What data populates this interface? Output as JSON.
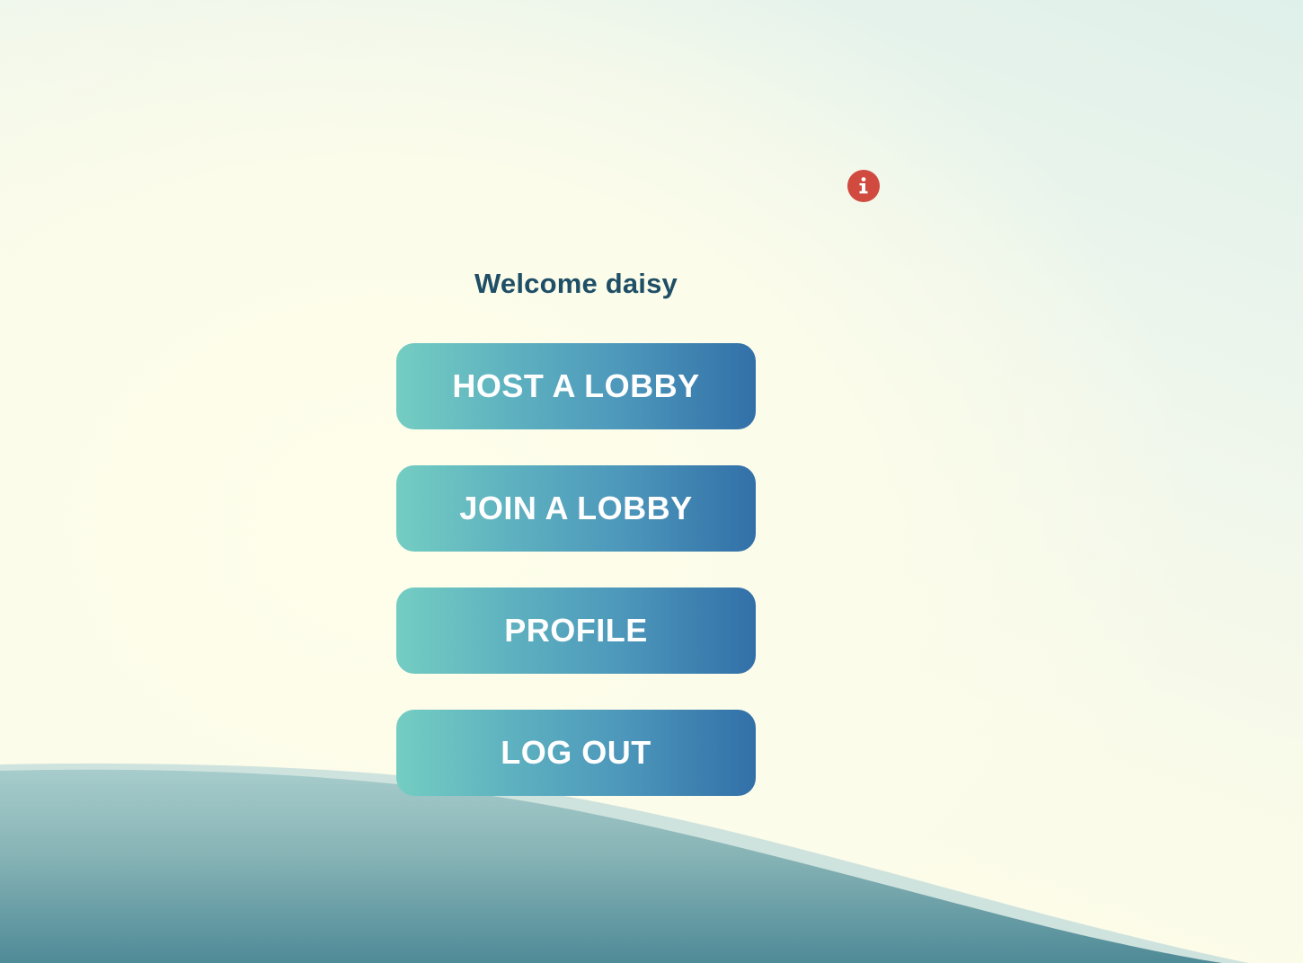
{
  "header": {
    "info_icon": "info-icon",
    "info_icon_color": "#d04a3f"
  },
  "main": {
    "welcome_text": "Welcome daisy",
    "buttons": [
      {
        "label": "HOST A LOBBY",
        "name": "host-lobby-button"
      },
      {
        "label": "JOIN A LOBBY",
        "name": "join-lobby-button"
      },
      {
        "label": "PROFILE",
        "name": "profile-button"
      },
      {
        "label": "LOG OUT",
        "name": "logout-button"
      }
    ]
  },
  "theme": {
    "title_color": "#1f4f66",
    "button_gradient_start": "#74cdc2",
    "button_gradient_end": "#3270a8",
    "wave_color": "#4f8a97"
  }
}
